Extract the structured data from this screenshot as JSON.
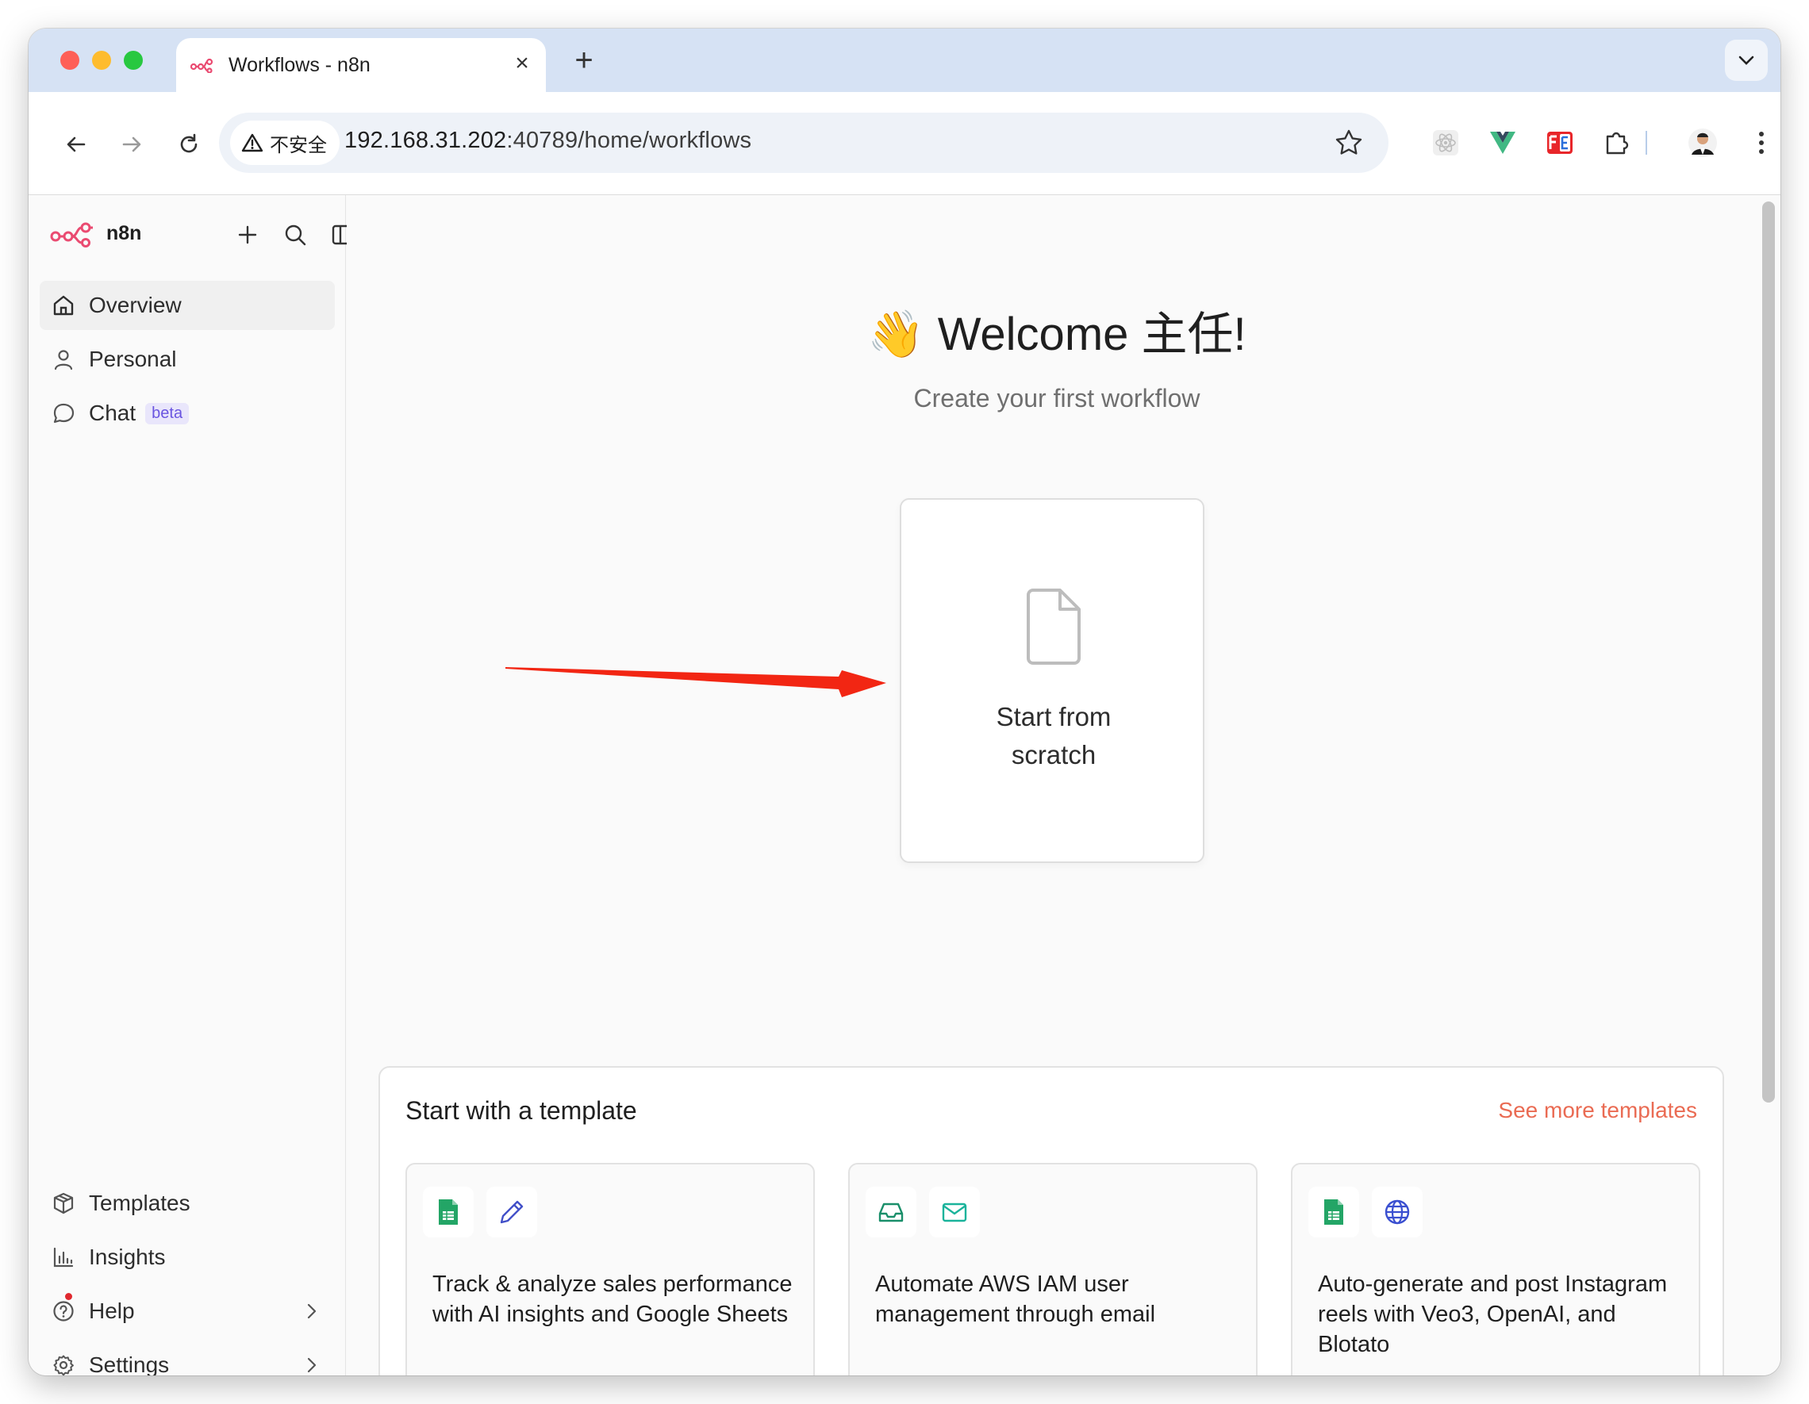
{
  "browser": {
    "tab_title": "Workflows - n8n",
    "tab_close": "×",
    "new_tab": "+",
    "security_label": "不安全",
    "url_host": "192.168.31.202",
    "url_path": ":40789/home/workflows"
  },
  "sidebar": {
    "logo_text": "n8n",
    "nav": [
      {
        "label": "Overview",
        "icon": "home-icon",
        "active": true
      },
      {
        "label": "Personal",
        "icon": "user-icon"
      },
      {
        "label": "Chat",
        "icon": "chat-icon",
        "badge": "beta"
      }
    ],
    "bottom": [
      {
        "label": "Templates",
        "icon": "box-icon"
      },
      {
        "label": "Insights",
        "icon": "bar-chart-icon"
      },
      {
        "label": "Help",
        "icon": "help-icon"
      },
      {
        "label": "Settings",
        "icon": "gear-icon"
      }
    ]
  },
  "main": {
    "welcome_emoji": "👋",
    "welcome_text": "Welcome 主任!",
    "subtitle": "Create your first workflow",
    "scratch_line1": "Start from",
    "scratch_line2": "scratch"
  },
  "templates": {
    "title": "Start with a template",
    "see_more": "See more templates",
    "cards": [
      {
        "text": "Track & analyze sales performance with AI insights and Google Sheets",
        "icons": [
          "google-sheets-icon",
          "pencil-icon"
        ]
      },
      {
        "text": "Automate AWS IAM user management through email",
        "icons": [
          "inbox-icon",
          "mail-icon"
        ]
      },
      {
        "text": "Auto-generate and post Instagram reels with Veo3, OpenAI, and Blotato",
        "icons": [
          "google-sheets-icon",
          "globe-icon"
        ]
      }
    ]
  },
  "colors": {
    "accent": "#ea6b53",
    "brand": "#ea4b71",
    "annotation_arrow": "#f22613"
  }
}
